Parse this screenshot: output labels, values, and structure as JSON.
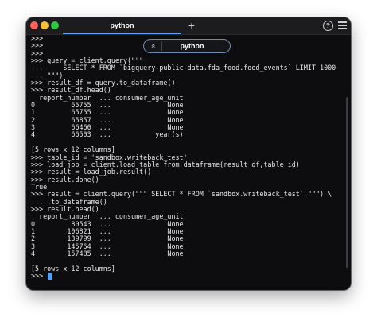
{
  "tab": {
    "title": "python"
  },
  "overlay": {
    "label": "python",
    "icon": "chevron-double-up-icon"
  },
  "titlebar": {
    "new_tab_label": "+",
    "help_label": "?"
  },
  "terminal": {
    "lines": [
      ">>>",
      ">>>",
      ">>>",
      ">>> query = client.query(\"\"\"",
      "...     SELECT * FROM `bigquery-public-data.fda_food.food_events` LIMIT 1000",
      "... \"\"\")",
      ">>> result_df = query.to_dataframe()",
      ">>> result_df.head()",
      "  report_number  ... consumer_age_unit",
      "0         65755  ...              None",
      "1         65755  ...              None",
      "2         65857  ...              None",
      "3         66460  ...              None",
      "4         66503  ...           year(s)",
      "",
      "[5 rows x 12 columns]",
      ">>> table_id = 'sandbox.writeback_test'",
      ">>> load_job = client.load_table_from_dataframe(result_df,table_id)",
      ">>> result = load_job.result()",
      ">>> result.done()",
      "True",
      ">>> result = client.query(\"\"\" SELECT * FROM `sandbox.writeback_test` \"\"\") \\",
      "... .to_dataframe()",
      ">>> result.head()",
      "  report_number  ... consumer_age_unit",
      "0         80543  ...              None",
      "1        106821  ...              None",
      "2        139799  ...              None",
      "3        145764  ...              None",
      "4        157485  ...              None",
      "",
      "[5 rows x 12 columns]"
    ],
    "prompt": ">>> "
  },
  "colors": {
    "background": "#0d0d0f",
    "text": "#e8e8e8",
    "tab_underline": "#5aa0f0",
    "cursor": "#4aa3ff"
  }
}
